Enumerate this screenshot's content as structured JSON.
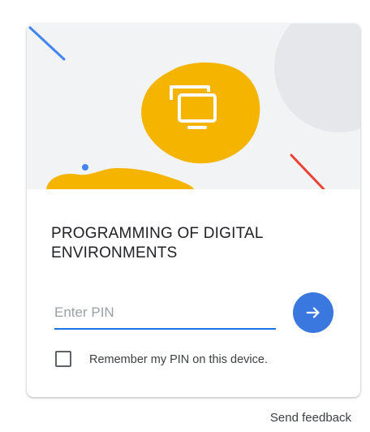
{
  "card": {
    "title": "PROGRAMMING OF DIGITAL ENVIRONMENTS",
    "hero_icon": "monitor-stack-icon"
  },
  "pin": {
    "placeholder": "Enter PIN",
    "value": ""
  },
  "submit": {
    "icon": "arrow-right-icon"
  },
  "remember": {
    "label": "Remember my PIN on this device.",
    "checked": false
  },
  "footer": {
    "feedback_label": "Send feedback"
  },
  "colors": {
    "accent": "#1a73e8",
    "button": "#3a78e0",
    "illustration_yellow": "#f4b400",
    "line_blue": "#4285f4",
    "line_red": "#ea4335",
    "hero_background": "#f1f3f4"
  }
}
